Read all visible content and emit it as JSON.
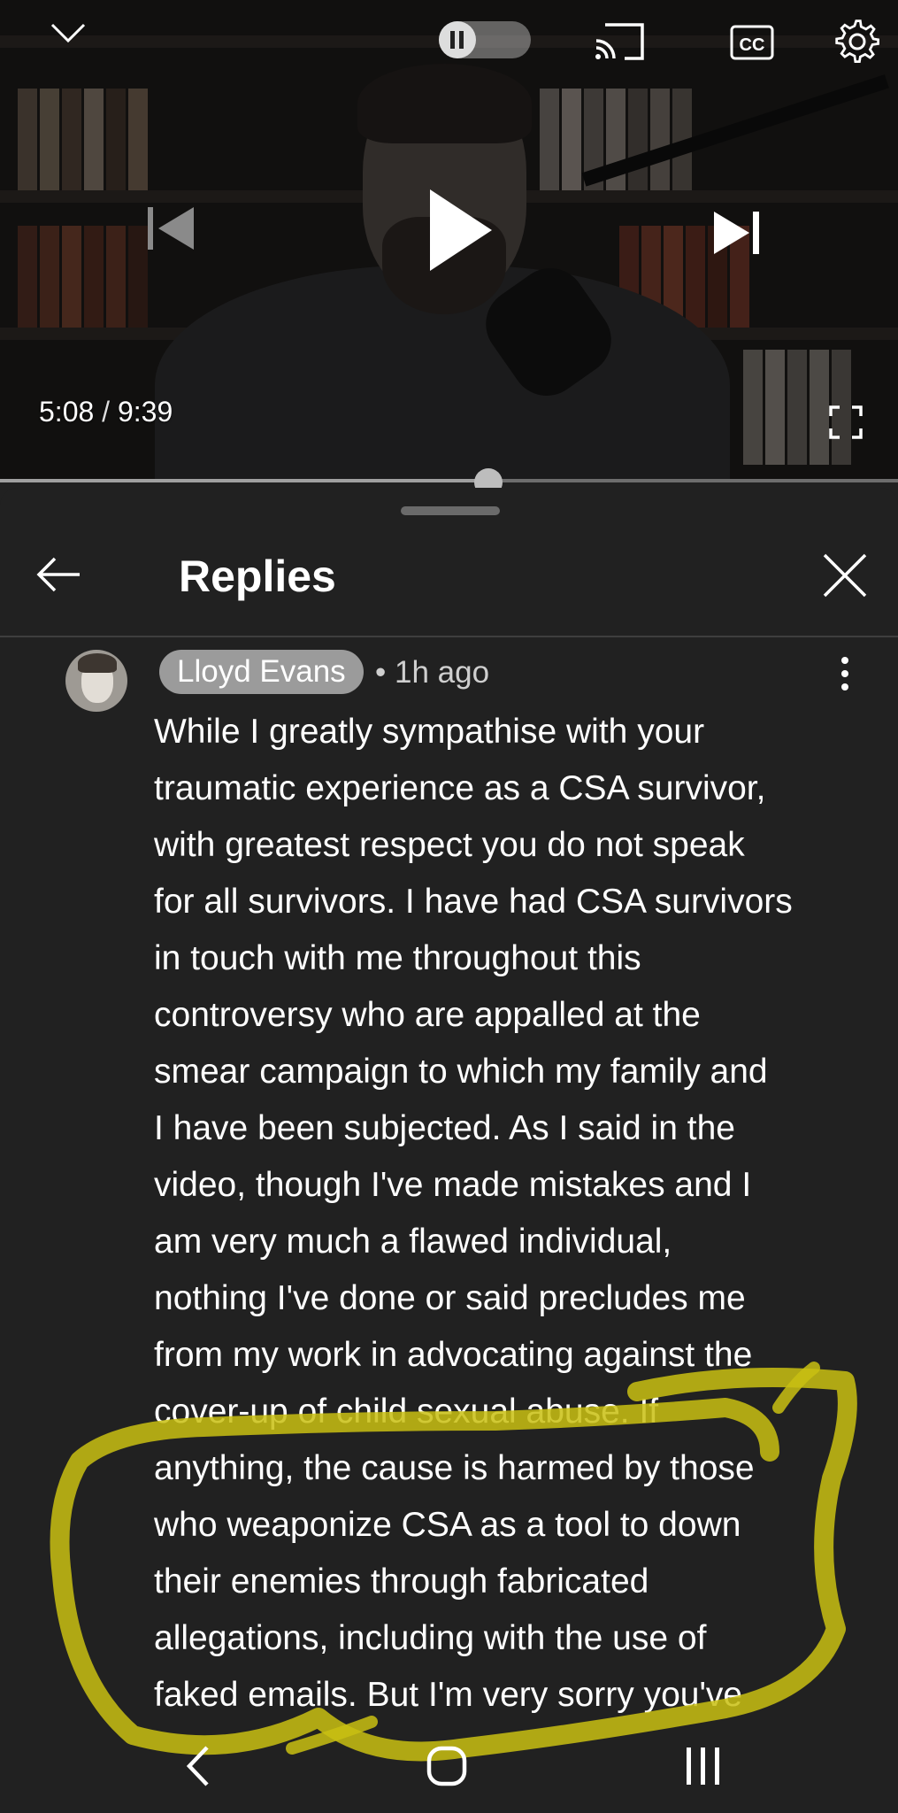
{
  "player": {
    "current_time": "5:08",
    "time_separator": "/",
    "duration": "9:39",
    "progress_fraction": 0.544,
    "cc_label": "CC",
    "autoplay_state": "paused"
  },
  "replies_panel": {
    "title": "Replies"
  },
  "comment": {
    "author": "Lloyd Evans",
    "meta": "• 1h ago",
    "lines": [
      "While I greatly sympathise with your",
      "traumatic experience as a CSA survivor,",
      "with greatest respect you do not speak",
      "for all survivors. I have had CSA survivors",
      "in touch with me throughout this",
      "controversy who are appalled at the",
      "smear campaign to which my family and",
      "I have been subjected. As I said in the",
      "video, though I've made mistakes and I",
      "am very much a flawed individual,",
      "nothing I've done or said precludes me",
      "from my work in advocating against the",
      "cover-up of child sexual abuse. If",
      "anything, the cause is harmed by those",
      "who weaponize CSA as a tool to down",
      "their enemies through fabricated",
      "allegations, including with the use of",
      "faked emails. But I'm very sorry you've"
    ]
  },
  "colors": {
    "highlight_scribble": "#c9bf12",
    "panel_bg": "#212121"
  },
  "icons": [
    "chevron-down-icon",
    "pause-icon",
    "cast-icon",
    "cc-icon",
    "gear-icon",
    "skip-previous-icon",
    "play-icon",
    "skip-next-icon",
    "fullscreen-icon",
    "arrow-left-icon",
    "close-icon",
    "more-vert-icon",
    "nav-back-icon",
    "nav-home-icon",
    "nav-recent-icon"
  ]
}
